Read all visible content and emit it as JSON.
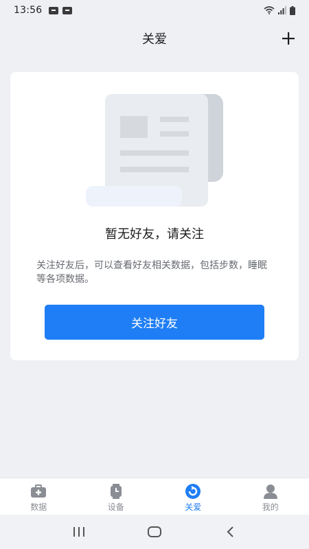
{
  "status_bar": {
    "time": "13:56"
  },
  "header": {
    "title": "关爱",
    "add_icon": "plus-icon"
  },
  "empty_state": {
    "title": "暂无好友，请关注",
    "description": "关注好友后，可以查看好友相关数据，包括步数，睡眠等各项数据。",
    "button_label": "关注好友"
  },
  "tabs": [
    {
      "label": "数据",
      "icon": "medical-kit-icon",
      "active": false
    },
    {
      "label": "设备",
      "icon": "watch-icon",
      "active": false
    },
    {
      "label": "关爱",
      "icon": "care-icon",
      "active": true
    },
    {
      "label": "我的",
      "icon": "user-icon",
      "active": false
    }
  ],
  "colors": {
    "accent": "#1f7ef5",
    "background": "#eef0f4",
    "inactive_tab": "#8a8d93"
  }
}
